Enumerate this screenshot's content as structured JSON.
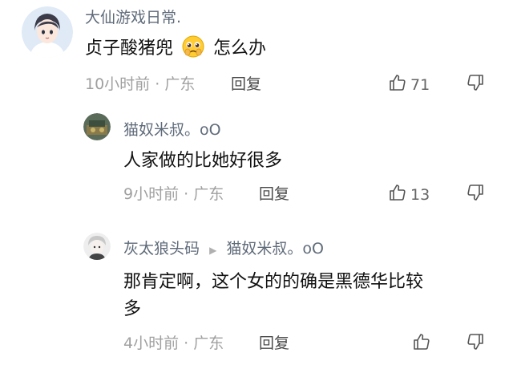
{
  "comment": {
    "username": "大仙游戏日常.",
    "text": "贞子酸猪兜",
    "text_suffix": "怎么办",
    "emoji": "pleading-face-emoji",
    "time": "10小时前",
    "location": "广东",
    "reply_label": "回复",
    "likes": "71"
  },
  "replies": [
    {
      "username": "猫奴米叔。oO",
      "text": "人家做的比她好很多",
      "time": "9小时前",
      "location": "广东",
      "reply_label": "回复",
      "likes": "13"
    },
    {
      "username": "灰太狼头码",
      "reply_to": "猫奴米叔。oO",
      "text_line1": "那肯定啊，这个女的的确是黑德华比较",
      "text_line2": "多",
      "time": "4小时前",
      "location": "广东",
      "reply_label": "回复",
      "likes": ""
    }
  ],
  "separator": " · ",
  "icons": {
    "like": "thumbs-up-icon",
    "dislike": "thumbs-down-icon",
    "reply_arrow": "right-triangle-icon"
  }
}
